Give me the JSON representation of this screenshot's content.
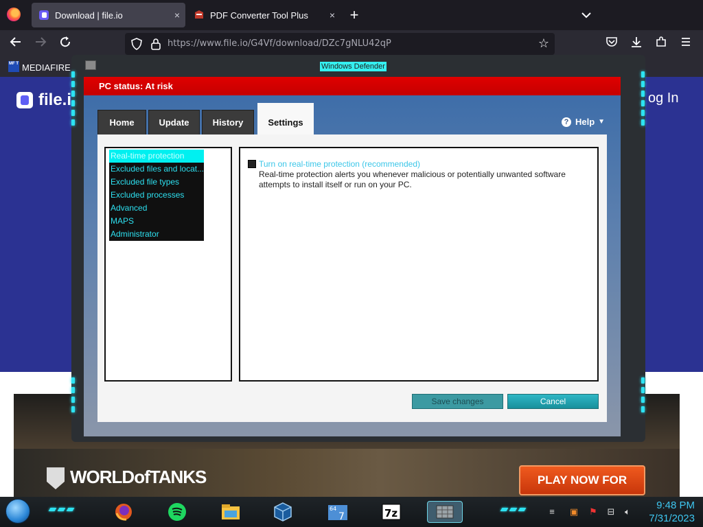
{
  "browser": {
    "tabs": [
      {
        "label": "Download | file.io",
        "active": true,
        "close": "×"
      },
      {
        "label": "PDF Converter Tool Plus",
        "active": false,
        "close": "×"
      }
    ],
    "new_tab": "+",
    "tab_list": "⌄",
    "url": "https://www.file.io/G4Vf/download/DZc7gNLU42qP",
    "bookmark_label": "MEDIAFIRE R",
    "bookmark_icon_text": "MF T"
  },
  "webpage": {
    "logo_text": "file.io",
    "login_text": "og In",
    "ad": {
      "logo_text": "WORLDofTANKS",
      "cta_text": "PLAY NOW FOR FREE"
    }
  },
  "defender": {
    "window_title": "Windows Defender",
    "status": "PC status: At risk",
    "tabs": [
      {
        "label": "Home"
      },
      {
        "label": "Update"
      },
      {
        "label": "History"
      },
      {
        "label": "Settings"
      }
    ],
    "help_label": "Help",
    "settings_list": [
      "Real-time protection",
      "Excluded files and locat...",
      "Excluded file types",
      "Excluded processes",
      "Advanced",
      "MAPS",
      "Administrator"
    ],
    "realtime_checkbox_label": "Turn on real-time protection (recommended)",
    "realtime_checked": false,
    "realtime_description": "Real-time protection alerts you whenever malicious or potentially unwanted software attempts to install itself or run on your PC.",
    "save_button": "Save changes",
    "cancel_button": "Cancel"
  },
  "taskbar": {
    "time": "9:48 PM",
    "date": "7/31/2023",
    "apps": [
      "firefox-icon",
      "spotify-icon",
      "file-explorer-icon",
      "virtualbox-icon",
      "7-64bit-icon",
      "7zip-icon",
      "defender-icon"
    ]
  },
  "colors": {
    "accent_cyan": "#2de3f2",
    "status_red": "#d40000",
    "site_blue": "#2b3292"
  }
}
